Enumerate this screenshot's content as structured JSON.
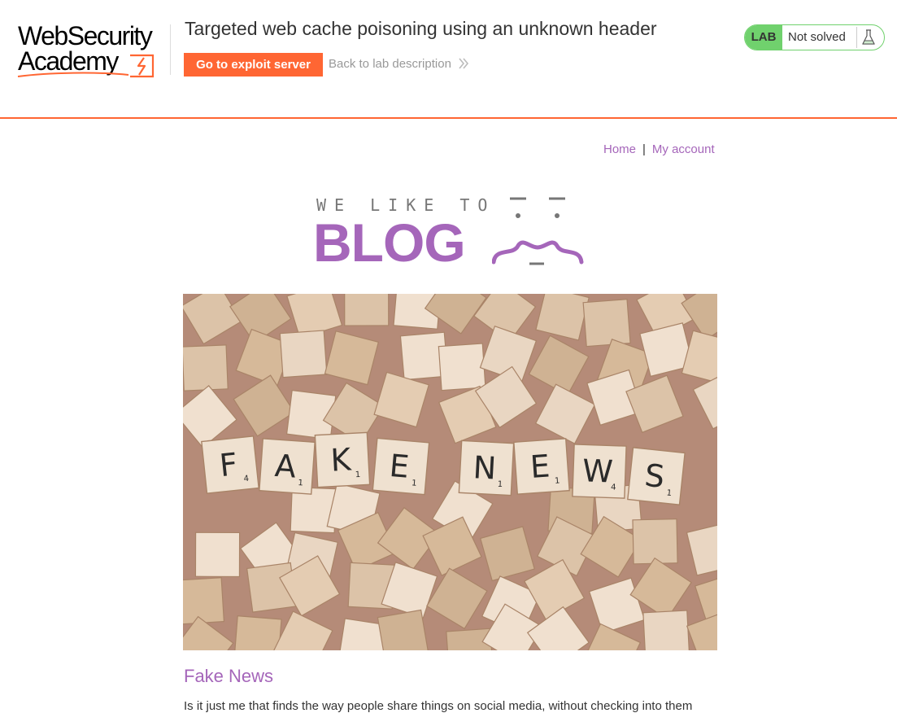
{
  "academy": {
    "logo_line1": "WebSecurity",
    "logo_line2": "Academy",
    "lab_title": "Targeted web cache poisoning using an unknown header",
    "exploit_button": "Go to exploit server",
    "back_link": "Back to lab description",
    "status_label": "LAB",
    "status_text": "Not solved",
    "colors": {
      "accent": "#ff6633",
      "status_green": "#70d16d"
    }
  },
  "blog": {
    "nav": {
      "home": "Home",
      "separator": "|",
      "my_account": "My account"
    },
    "logo_tagline": "WE LIKE TO",
    "logo_word": "BLOG",
    "accent_color": "#a566ba",
    "post": {
      "image_letters": [
        "F",
        "A",
        "K",
        "E",
        "N",
        "E",
        "W",
        "S"
      ],
      "image_scores": [
        "4",
        "1",
        "1",
        "1",
        "1",
        "1",
        "4",
        "1"
      ],
      "title": "Fake News",
      "summary": "Is it just me that finds the way people share things on social media, without checking into them"
    }
  }
}
